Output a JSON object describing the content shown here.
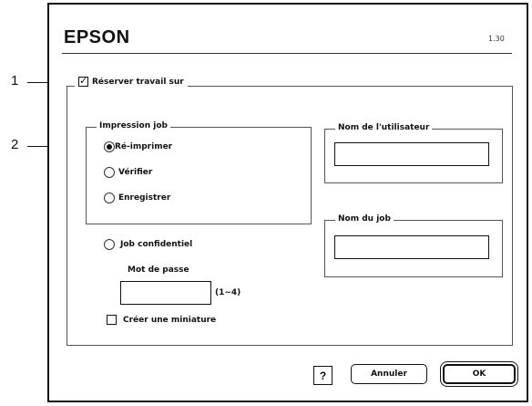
{
  "callouts": [
    "1",
    "2"
  ],
  "header": {
    "brand": "EPSON",
    "version": "1.30"
  },
  "reserve": {
    "label": "Réserver travail sur",
    "checked": true
  },
  "job_group": {
    "title": "Impression job",
    "options": [
      {
        "label": "Ré-imprimer",
        "selected": true
      },
      {
        "label": "Vérifier",
        "selected": false
      },
      {
        "label": "Enregistrer",
        "selected": false
      }
    ]
  },
  "confidential": {
    "label": "Job confidentiel",
    "selected": false,
    "password_label": "Mot de passe",
    "password_value": "",
    "password_hint": "(1~4)"
  },
  "thumbnail": {
    "label": "Créer une miniature",
    "checked": false
  },
  "user_name": {
    "title": "Nom de l'utilisateur",
    "value": ""
  },
  "job_name": {
    "title": "Nom du job",
    "value": ""
  },
  "buttons": {
    "help": "?",
    "cancel": "Annuler",
    "ok": "OK"
  }
}
